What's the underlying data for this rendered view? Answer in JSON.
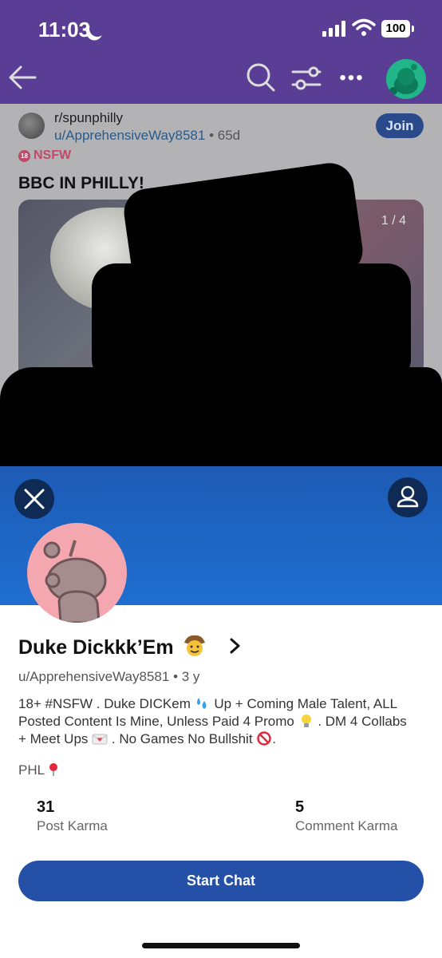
{
  "status_bar": {
    "time": "11:03",
    "battery": "100"
  },
  "post": {
    "subreddit": "r/spunphilly",
    "author": "u/ApprehensiveWay8581",
    "separator": "•",
    "age": "65d",
    "join_label": "Join",
    "nsfw_label": "NSFW",
    "nsfw_icon_text": "18",
    "title": "BBC IN PHILLY!",
    "image_counter": "1 / 4"
  },
  "profile": {
    "display_name": "Duke Dickkk’Em",
    "username": "u/ApprehensiveWay8581",
    "separator": "•",
    "account_age": "3 y",
    "bio_part1": "18+ #NSFW . Duke DICKem",
    "bio_part2": "Up + Coming Male Talent, ALL Posted Content Is Mine, Unless Paid 4 Promo",
    "bio_part3": ". DM 4 Collabs + Meet Ups",
    "bio_part4": ". No Games No Bullshit",
    "bio_part5": ".",
    "location": "PHL",
    "post_karma_value": "31",
    "post_karma_label": "Post Karma",
    "comment_karma_value": "5",
    "comment_karma_label": "Comment Karma",
    "start_chat_label": "Start Chat"
  },
  "icons": {
    "back": "arrow-left-icon",
    "search": "search-icon",
    "filter": "filter-icon",
    "more": "more-icon",
    "close": "close-icon",
    "profile": "user-icon",
    "chevron": "chevron-right-icon"
  },
  "colors": {
    "header": "#5a3d94",
    "banner": "#1f6fd1",
    "chat_button": "#2550a8",
    "avatar_bg": "#f5a7b0",
    "nsfw": "#c04a6a"
  }
}
